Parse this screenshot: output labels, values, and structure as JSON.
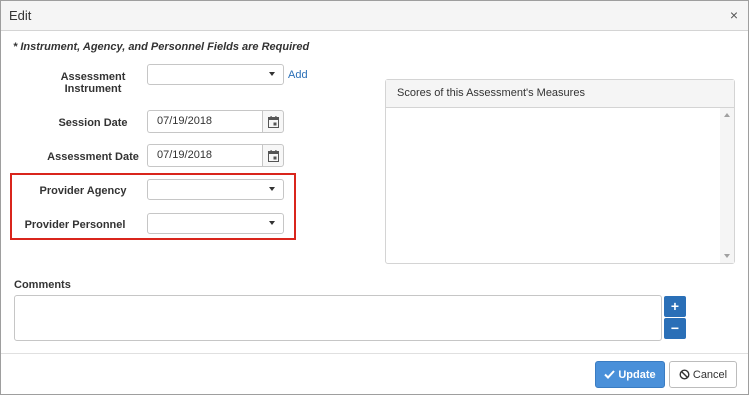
{
  "dialog": {
    "title": "Edit",
    "close_glyph": "×"
  },
  "required_note": "* Instrument, Agency, and Personnel Fields are Required",
  "fields": {
    "assessment_instrument": {
      "label": "Assessment Instrument",
      "value": "",
      "add_link": "Add"
    },
    "session_date": {
      "label": "Session Date",
      "value": "07/19/2018"
    },
    "assessment_date": {
      "label": "Assessment Date",
      "value": "07/19/2018"
    },
    "provider_agency": {
      "label": "Provider Agency",
      "value": ""
    },
    "provider_personnel": {
      "label": "Provider Personnel",
      "value": ""
    }
  },
  "scores_panel": {
    "title": "Scores of this Assessment's Measures"
  },
  "comments": {
    "label": "Comments",
    "value": "",
    "add_glyph": "+",
    "remove_glyph": "−"
  },
  "footer": {
    "update_label": "Update",
    "cancel_label": "Cancel"
  },
  "icons": {
    "calendar": "calendar-icon",
    "check": "check-icon",
    "cancel": "ban-icon",
    "dropdown": "caret-down-icon"
  },
  "colors": {
    "primary": "#4a90d9",
    "link": "#2a6fb7",
    "highlight": "#d9251c"
  }
}
